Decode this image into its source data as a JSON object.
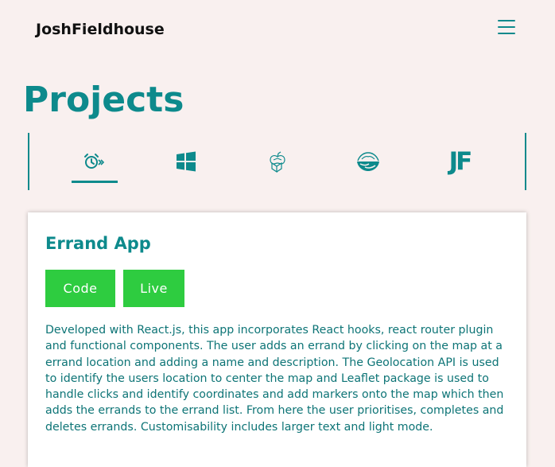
{
  "header": {
    "brand": "JoshFieldhouse",
    "menu_icon": "hamburger-menu-icon"
  },
  "page": {
    "title": "Projects"
  },
  "tabs": [
    {
      "icon": "alarm-clock-icon",
      "active": true
    },
    {
      "icon": "windows-icon",
      "active": false
    },
    {
      "icon": "apples-icon",
      "active": false
    },
    {
      "icon": "landscape-icon",
      "active": false
    },
    {
      "icon": "jf-logo-icon",
      "label": "JF",
      "active": false
    }
  ],
  "project": {
    "title": "Errand App",
    "code_label": "Code",
    "live_label": "Live",
    "description": "Developed with React.js, this app incorporates React hooks, react router plugin and functional components. The user adds an errand by clicking on the map at a errand location and adding a name and description. The Geolocation API is used to identify the users location to center the map and Leaflet package is used to handle clicks and identify coordinates and add markers onto the map which then adds the errands to the errand list. From here the user prioritises, completes and deletes errands. Customisability includes larger text and light mode."
  },
  "colors": {
    "background": "#f9f0ef",
    "accent": "#0d8a8c",
    "button": "#2ecc40",
    "text": "#0d7476"
  }
}
